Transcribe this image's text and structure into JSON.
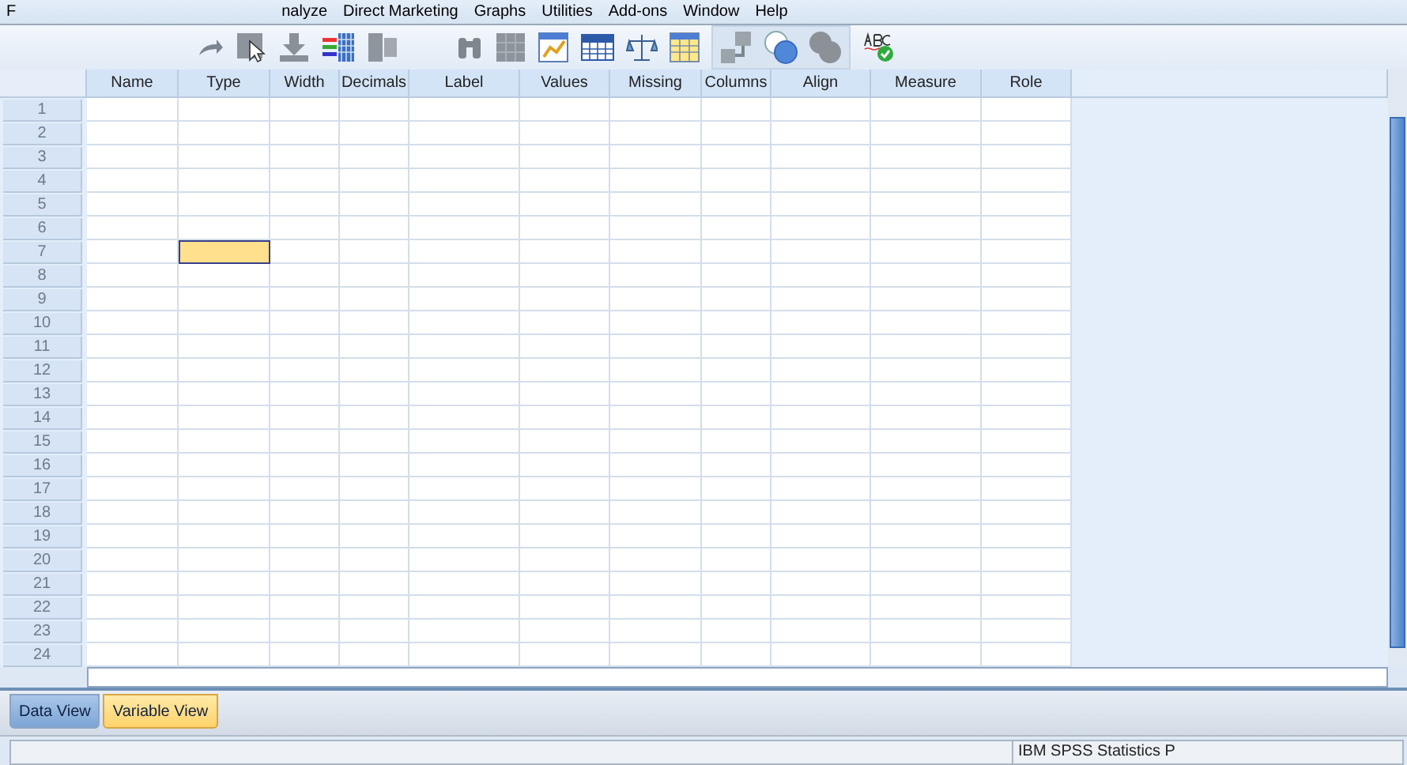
{
  "menu": [
    "F",
    "nalyze",
    "Direct Marketing",
    "Graphs",
    "Utilities",
    "Add-ons",
    "Window",
    "Help"
  ],
  "table": {
    "columns": [
      "Name",
      "Type",
      "Width",
      "Decimals",
      "Label",
      "Values",
      "Missing",
      "Columns",
      "Align",
      "Measure",
      "Role"
    ],
    "rows": [
      {
        "number": "1",
        "selected_cells": [
          false,
          false,
          false,
          false,
          false,
          false,
          false,
          false,
          false,
          false,
          false
        ]
      },
      {
        "number": "2",
        "selected_cells": [
          false,
          false,
          false,
          false,
          false,
          false,
          false,
          false,
          false,
          false,
          false
        ]
      },
      {
        "number": "3",
        "selected_cells": [
          false,
          false,
          false,
          false,
          false,
          false,
          false,
          false,
          false,
          false,
          false
        ]
      },
      {
        "number": "4",
        "selected_cells": [
          false,
          false,
          false,
          false,
          false,
          false,
          false,
          false,
          false,
          false,
          false
        ]
      },
      {
        "number": "5",
        "selected_cells": [
          false,
          false,
          false,
          false,
          false,
          false,
          false,
          false,
          false,
          false,
          false
        ]
      },
      {
        "number": "6",
        "selected_cells": [
          false,
          false,
          false,
          false,
          false,
          false,
          false,
          false,
          false,
          false,
          false
        ]
      },
      {
        "number": "7",
        "selected_cells": [
          false,
          true,
          false,
          false,
          false,
          false,
          false,
          false,
          false,
          false,
          false
        ]
      },
      {
        "number": "8",
        "selected_cells": [
          false,
          false,
          false,
          false,
          false,
          false,
          false,
          false,
          false,
          false,
          false
        ]
      },
      {
        "number": "9",
        "selected_cells": [
          false,
          false,
          false,
          false,
          false,
          false,
          false,
          false,
          false,
          false,
          false
        ]
      },
      {
        "number": "10",
        "selected_cells": [
          false,
          false,
          false,
          false,
          false,
          false,
          false,
          false,
          false,
          false,
          false
        ]
      },
      {
        "number": "11",
        "selected_cells": [
          false,
          false,
          false,
          false,
          false,
          false,
          false,
          false,
          false,
          false,
          false
        ]
      },
      {
        "number": "12",
        "selected_cells": [
          false,
          false,
          false,
          false,
          false,
          false,
          false,
          false,
          false,
          false,
          false
        ]
      },
      {
        "number": "13",
        "selected_cells": [
          false,
          false,
          false,
          false,
          false,
          false,
          false,
          false,
          false,
          false,
          false
        ]
      },
      {
        "number": "14",
        "selected_cells": [
          false,
          false,
          false,
          false,
          false,
          false,
          false,
          false,
          false,
          false,
          false
        ]
      },
      {
        "number": "15",
        "selected_cells": [
          false,
          false,
          false,
          false,
          false,
          false,
          false,
          false,
          false,
          false,
          false
        ]
      },
      {
        "number": "16",
        "selected_cells": [
          false,
          false,
          false,
          false,
          false,
          false,
          false,
          false,
          false,
          false,
          false
        ]
      },
      {
        "number": "17",
        "selected_cells": [
          false,
          false,
          false,
          false,
          false,
          false,
          false,
          false,
          false,
          false,
          false
        ]
      },
      {
        "number": "18",
        "selected_cells": [
          false,
          false,
          false,
          false,
          false,
          false,
          false,
          false,
          false,
          false,
          false
        ]
      },
      {
        "number": "19",
        "selected_cells": [
          false,
          false,
          false,
          false,
          false,
          false,
          false,
          false,
          false,
          false,
          false
        ]
      },
      {
        "number": "20",
        "selected_cells": [
          false,
          false,
          false,
          false,
          false,
          false,
          false,
          false,
          false,
          false,
          false
        ]
      },
      {
        "number": "21",
        "selected_cells": [
          false,
          false,
          false,
          false,
          false,
          false,
          false,
          false,
          false,
          false,
          false
        ]
      },
      {
        "number": "22",
        "selected_cells": [
          false,
          false,
          false,
          false,
          false,
          false,
          false,
          false,
          false,
          false,
          false
        ]
      },
      {
        "number": "23",
        "selected_cells": [
          false,
          false,
          false,
          false,
          false,
          false,
          false,
          false,
          false,
          false,
          false
        ]
      },
      {
        "number": "24",
        "selected_cells": [
          false,
          false,
          false,
          false,
          false,
          false,
          false,
          false,
          false,
          false,
          false
        ]
      }
    ]
  },
  "tabs": [
    {
      "label": "Data View",
      "selected": false
    },
    {
      "label": "Variable View",
      "selected": true
    }
  ],
  "status_bar": "IBM SPSS Statistics P"
}
